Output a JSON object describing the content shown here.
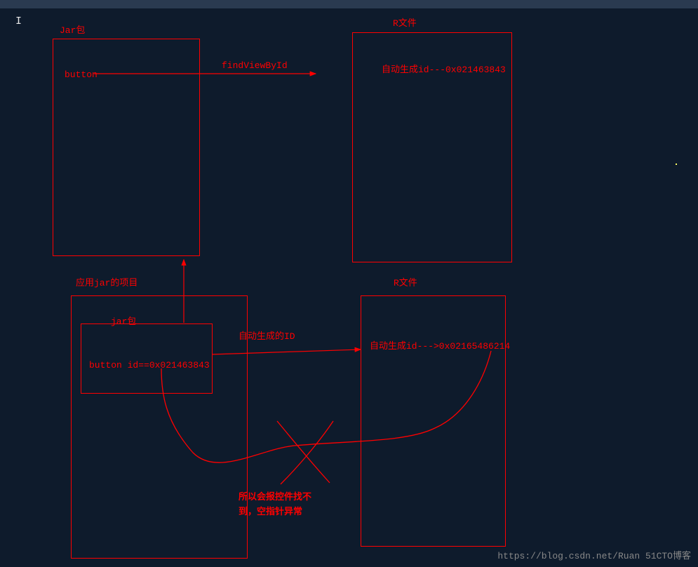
{
  "labels": {
    "jar_top": "Jar包",
    "r_file_top": "R文件",
    "r_file_bottom": "R文件",
    "button_text": "button",
    "findViewById": "findViewById",
    "auto_id_top": "自动生成id---0x021463843",
    "project_title": "应用jar的项目",
    "jar_inner": "jar包",
    "button_id": "button id==0x021463843",
    "auto_gen_id": "自动生成的ID",
    "auto_id_bottom": "自动生成id--->0x02165486214",
    "error_msg_line1": "所以会报控件找不",
    "error_msg_line2": "到，空指针异常"
  },
  "watermark": {
    "url": "https://blog.csdn.net/Ruan 51CTO博客"
  }
}
